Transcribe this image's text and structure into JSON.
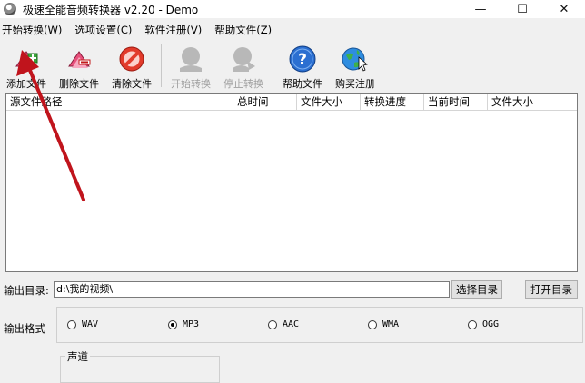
{
  "window": {
    "title": "极速全能音频转换器 v2.20 - Demo",
    "controls": {
      "minimize": "—",
      "maximize": "☐",
      "close": "✕"
    }
  },
  "menu": [
    {
      "label": "开始转换(W)"
    },
    {
      "label": "选项设置(C)"
    },
    {
      "label": "软件注册(V)"
    },
    {
      "label": "帮助文件(Z)"
    }
  ],
  "toolbar": [
    {
      "label": "添加文件",
      "icon": "add-file-icon",
      "enabled": true
    },
    {
      "label": "删除文件",
      "icon": "delete-file-icon",
      "enabled": true
    },
    {
      "label": "清除文件",
      "icon": "clear-files-icon",
      "enabled": true
    },
    {
      "label": "开始转换",
      "icon": "start-convert-icon",
      "enabled": false
    },
    {
      "label": "停止转换",
      "icon": "stop-convert-icon",
      "enabled": false
    },
    {
      "label": "帮助文件",
      "icon": "help-icon",
      "enabled": true
    },
    {
      "label": "购买注册",
      "icon": "buy-register-icon",
      "enabled": true
    }
  ],
  "file_list": {
    "columns": [
      "源文件路径",
      "总时间",
      "文件大小",
      "转换进度",
      "当前时间",
      "文件大小"
    ],
    "rows": []
  },
  "output": {
    "dir_label": "输出目录:",
    "dir_value": "d:\\我的视频\\",
    "select_button": "选择目录",
    "open_button": "打开目录"
  },
  "format": {
    "label": "输出格式",
    "options": [
      {
        "label": "WAV",
        "selected": false
      },
      {
        "label": "MP3",
        "selected": true
      },
      {
        "label": "AAC",
        "selected": false
      },
      {
        "label": "WMA",
        "selected": false
      },
      {
        "label": "OGG",
        "selected": false
      }
    ]
  },
  "channel": {
    "label": "声道"
  },
  "colors": {
    "annotation_arrow": "#c0141c",
    "window_bg": "#f0f0f0"
  }
}
